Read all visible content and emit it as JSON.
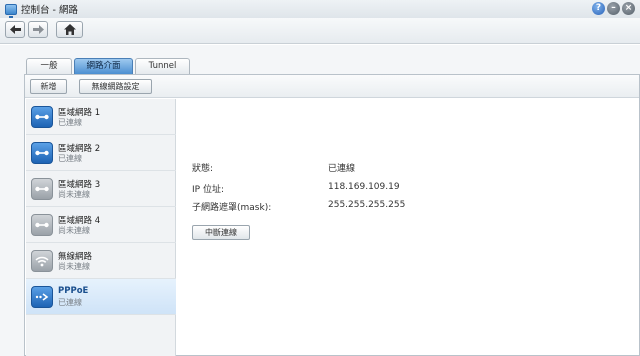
{
  "window": {
    "title": "控制台 - 網路"
  },
  "tabs": [
    {
      "label": "一般"
    },
    {
      "label": "網路介面"
    },
    {
      "label": "Tunnel"
    }
  ],
  "panel_toolbar": {
    "add_label": "新增",
    "wireless_label": "無線網路設定"
  },
  "interfaces": [
    {
      "name": "區域網路 1",
      "status": "已連線",
      "icon": "lan-icon",
      "connected": true
    },
    {
      "name": "區域網路 2",
      "status": "已連線",
      "icon": "lan-icon",
      "connected": true
    },
    {
      "name": "區域網路 3",
      "status": "尚未連線",
      "icon": "lan-icon",
      "connected": false
    },
    {
      "name": "區域網路 4",
      "status": "尚未連線",
      "icon": "lan-icon",
      "connected": false
    },
    {
      "name": "無線網路",
      "status": "尚未連線",
      "icon": "wifi-icon",
      "connected": false
    },
    {
      "name": "PPPoE",
      "status": "已連線",
      "icon": "pppoe-icon",
      "connected": true
    }
  ],
  "detail": {
    "status_label": "狀態:",
    "status_value": "已連線",
    "ip_label": "IP 位址:",
    "ip_value": "118.169.109.19",
    "mask_label": "子網路遮罩(mask):",
    "mask_value": "255.255.255.255",
    "disconnect_label": "中斷連線"
  },
  "colors": {
    "accent": "#4c8fd1",
    "selected_bg": "#cfe3f7"
  }
}
